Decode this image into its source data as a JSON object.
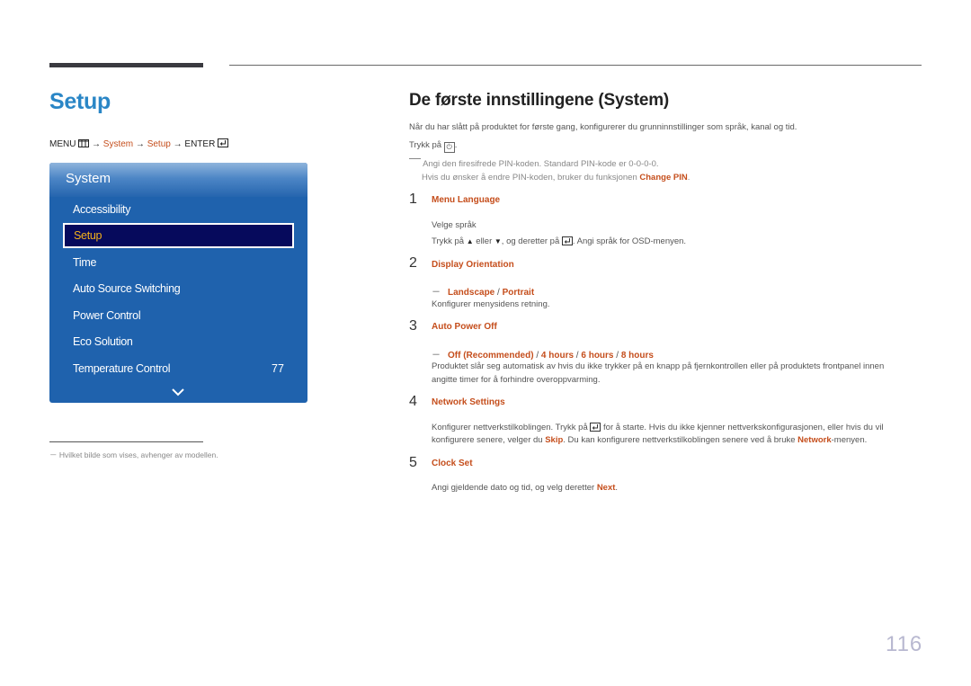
{
  "page": {
    "title": "Setup",
    "page_number": "116"
  },
  "menu_path": {
    "menu_label": "MENU",
    "menu_icon": "menu-icon",
    "arrow": "→",
    "system": "System",
    "setup": "Setup",
    "enter_label": "ENTER",
    "enter_icon": "enter-icon"
  },
  "osd": {
    "header": "System",
    "items": [
      {
        "label": "Accessibility"
      },
      {
        "label": "Setup",
        "selected": true
      },
      {
        "label": "Time"
      },
      {
        "label": "Auto Source Switching"
      },
      {
        "label": "Power Control"
      },
      {
        "label": "Eco Solution"
      },
      {
        "label": "Temperature Control",
        "value": "77"
      }
    ],
    "scroll_icon": "chevron-down-icon"
  },
  "footnote": "－ Hvilket bilde som vises, avhenger av modellen.",
  "section": {
    "title": "De første innstillingene (System)",
    "intro": "Når du har slått på produktet for første gang, konfigurerer du grunninnstillinger som språk, kanal og tid.",
    "press_prefix": "Trykk på",
    "press_suffix": ".",
    "note_line1": "Angi den firesifrede PIN-koden. Standard PIN-kode er 0-0-0-0.",
    "note_line2_prefix": "Hvis du ønsker å endre PIN-koden, bruker du funksjonen",
    "note_line2_link": "Change PIN",
    "note_line2_suffix": "."
  },
  "steps": [
    {
      "num": "1",
      "title": "Menu Language",
      "line1": "Velge språk",
      "line2_a": "Trykk på",
      "line2_b": "eller",
      "line2_c": ", og deretter på",
      "line2_d": ". Angi språk for OSD-menyen."
    },
    {
      "num": "2",
      "title": "Display Orientation",
      "options": [
        "Landscape",
        "Portrait"
      ],
      "desc": "Konfigurer menysidens retning."
    },
    {
      "num": "3",
      "title": "Auto Power Off",
      "options": [
        "Off (Recommended)",
        "4 hours",
        "6 hours",
        "8 hours"
      ],
      "desc1": "Produktet slår seg automatisk av hvis du ikke trykker på en knapp på fjernkontrollen eller på produktets frontpanel innen",
      "desc2": "angitte timer for å forhindre overoppvarming."
    },
    {
      "num": "4",
      "title": "Network Settings",
      "desc1_a": "Konfigurer nettverkstilkoblingen. Trykk på",
      "desc1_b": "for å starte. Hvis du ikke kjenner nettverkskonfigurasjonen, eller hvis du vil",
      "desc2_a": "konfigurere senere, velger du",
      "desc2_skip": "Skip",
      "desc2_b": ". Du kan konfigurere nettverkstilkoblingen senere ved å bruke",
      "desc2_network": "Network",
      "desc2_c": "-menyen."
    },
    {
      "num": "5",
      "title": "Clock Set",
      "desc_a": "Angi gjeldende dato og tid, og velg deretter",
      "desc_next": "Next",
      "desc_b": "."
    }
  ],
  "colors": {
    "title_blue": "#2a86c6",
    "accent_orange": "#c54e1c",
    "osd_blue": "#1f62ad",
    "osd_selected_bg": "#060a5c",
    "osd_selected_text": "#f4b21a"
  }
}
